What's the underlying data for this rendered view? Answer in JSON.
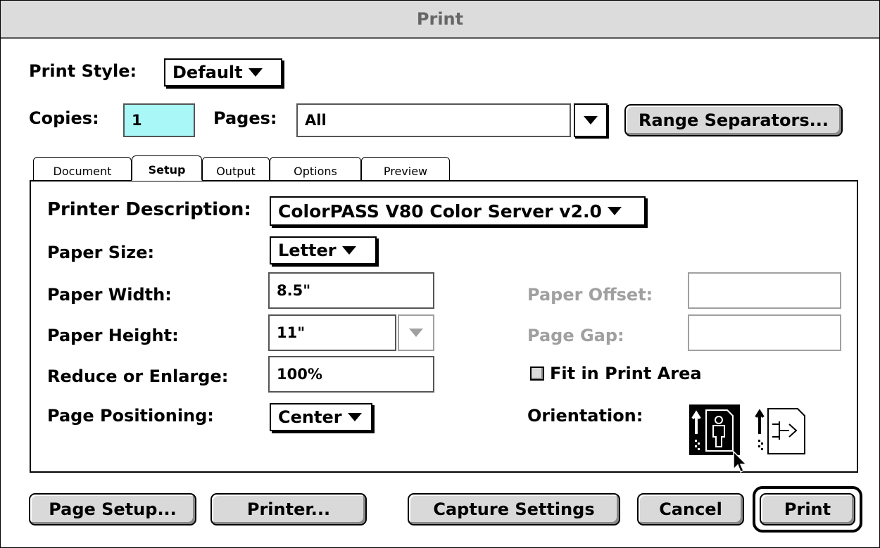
{
  "window": {
    "title": "Print"
  },
  "print_style": {
    "label": "Print Style:",
    "value": "Default"
  },
  "copies": {
    "label": "Copies:",
    "value": "1"
  },
  "pages": {
    "label": "Pages:",
    "value": "All"
  },
  "range_separators_button": "Range Separators...",
  "tabs": [
    {
      "label": "Document"
    },
    {
      "label": "Setup"
    },
    {
      "label": "Output"
    },
    {
      "label": "Options"
    },
    {
      "label": "Preview"
    }
  ],
  "setup": {
    "printer_description": {
      "label": "Printer Description:",
      "value": "ColorPASS V80 Color Server v2.0"
    },
    "paper_size": {
      "label": "Paper Size:",
      "value": "Letter"
    },
    "paper_width": {
      "label": "Paper Width:",
      "value": "8.5\""
    },
    "paper_height": {
      "label": "Paper Height:",
      "value": "11\""
    },
    "reduce_enlarge": {
      "label": "Reduce or Enlarge:",
      "value": "100%"
    },
    "page_positioning": {
      "label": "Page Positioning:",
      "value": "Center"
    },
    "paper_offset": {
      "label": "Paper Offset:",
      "value": ""
    },
    "page_gap": {
      "label": "Page Gap:",
      "value": ""
    },
    "fit_in_print_area": {
      "label": "Fit in Print Area",
      "checked": false
    },
    "orientation": {
      "label": "Orientation:",
      "selected": "portrait"
    }
  },
  "buttons": {
    "page_setup": "Page Setup...",
    "printer": "Printer...",
    "capture_settings": "Capture Settings",
    "cancel": "Cancel",
    "print": "Print"
  },
  "colors": {
    "copies_highlight": "#aaf7f7",
    "disabled_text": "#a0a0a0",
    "button_face": "#d9d9d9"
  },
  "icons": [
    "dropdown-arrow-icon",
    "portrait-orientation-icon",
    "landscape-orientation-icon",
    "mouse-cursor-icon"
  ]
}
